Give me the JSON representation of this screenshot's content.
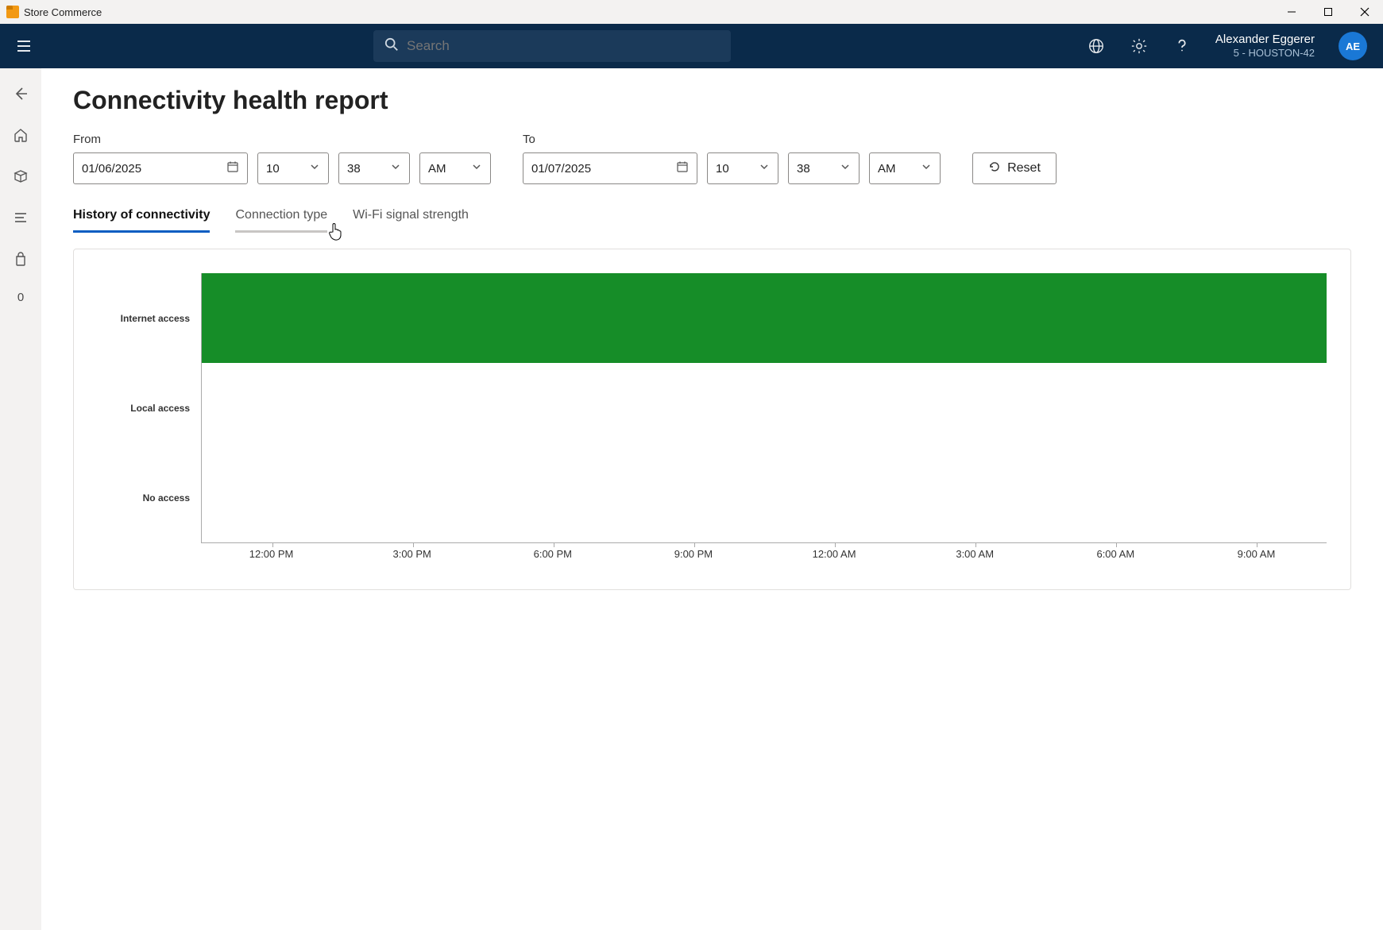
{
  "window": {
    "title": "Store Commerce"
  },
  "header": {
    "search_placeholder": "Search",
    "user_name": "Alexander Eggerer",
    "user_location": "5 - HOUSTON-42",
    "avatar_initials": "AE"
  },
  "sidebar": {
    "count_label": "0"
  },
  "page": {
    "title": "Connectivity health report",
    "from_label": "From",
    "to_label": "To",
    "from_date": "01/06/2025",
    "from_hour": "10",
    "from_minute": "38",
    "from_ampm": "AM",
    "to_date": "01/07/2025",
    "to_hour": "10",
    "to_minute": "38",
    "to_ampm": "AM",
    "reset_label": "Reset",
    "tabs": {
      "history": "History of connectivity",
      "connection_type": "Connection type",
      "wifi": "Wi-Fi signal strength"
    }
  },
  "chart_data": {
    "type": "bar",
    "title": "History of connectivity",
    "y_categories": [
      "Internet access",
      "Local access",
      "No access"
    ],
    "x_ticks": [
      "12:00 PM",
      "3:00 PM",
      "6:00 PM",
      "9:00 PM",
      "12:00 AM",
      "3:00 AM",
      "6:00 AM",
      "9:00 AM"
    ],
    "series": [
      {
        "name": "Internet access",
        "coverage_percent": 100
      },
      {
        "name": "Local access",
        "coverage_percent": 0
      },
      {
        "name": "No access",
        "coverage_percent": 0
      }
    ],
    "colors": {
      "internet": "#168d28"
    }
  }
}
